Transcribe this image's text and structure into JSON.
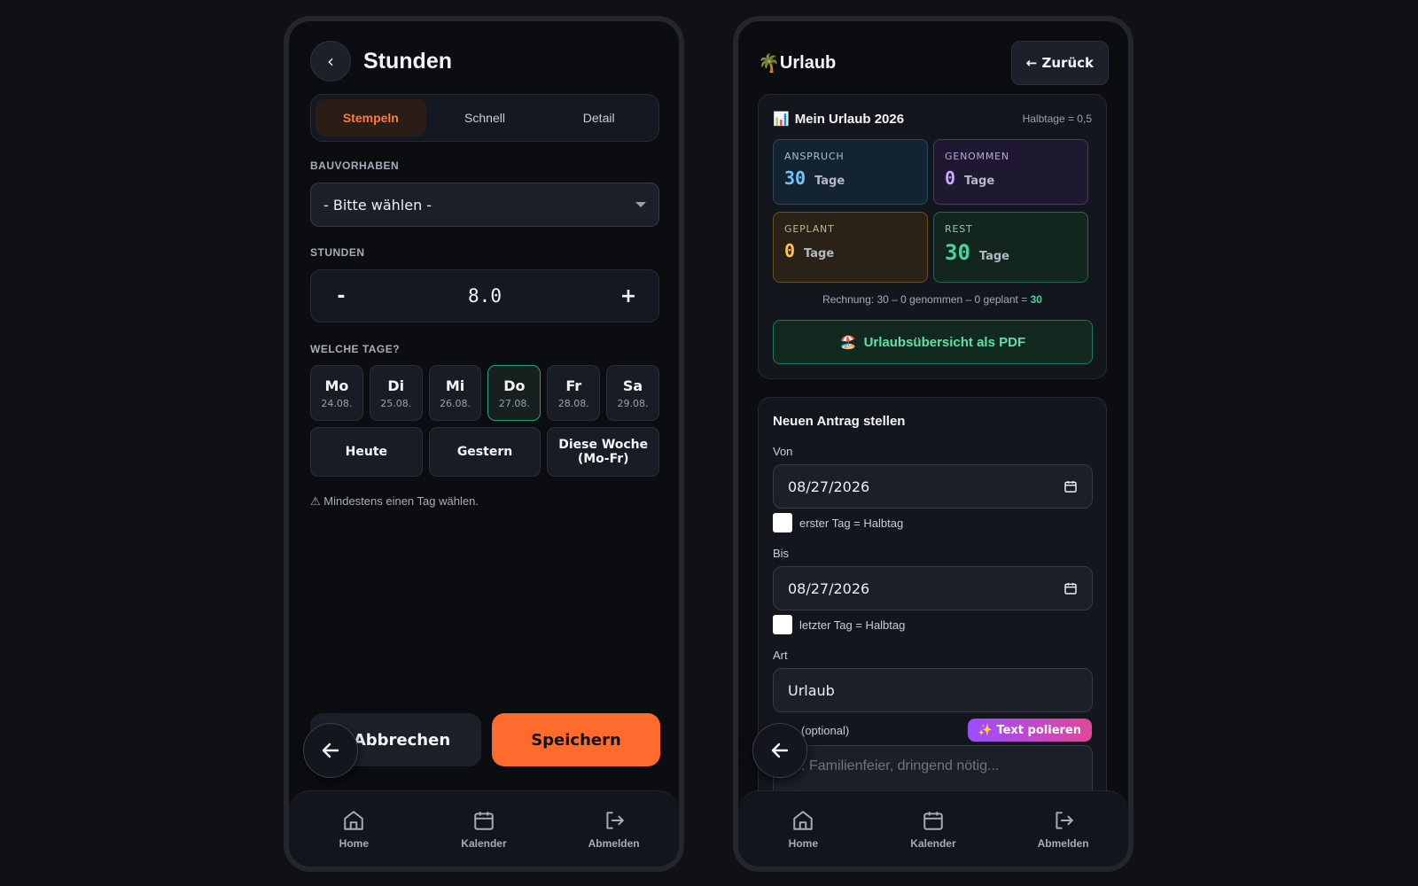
{
  "left": {
    "title": "Stunden",
    "tabs": [
      {
        "label": "Stempeln"
      },
      {
        "label": "Schnell"
      },
      {
        "label": "Detail"
      }
    ],
    "project_label": "BAUVORHABEN",
    "project_value": "- Bitte wählen -",
    "hours_label": "STUNDEN",
    "hours_minus": "-",
    "hours_value": "8.0",
    "hours_plus": "+",
    "days_label": "WELCHE TAGE?",
    "days": [
      {
        "name": "Mo",
        "date": "24.08."
      },
      {
        "name": "Di",
        "date": "25.08."
      },
      {
        "name": "Mi",
        "date": "26.08."
      },
      {
        "name": "Do",
        "date": "27.08."
      },
      {
        "name": "Fr",
        "date": "28.08."
      },
      {
        "name": "Sa",
        "date": "29.08."
      }
    ],
    "quick": [
      "Heute",
      "Gestern",
      "Diese Woche (Mo-Fr)"
    ],
    "warning": "⚠ Mindestens einen Tag wählen.",
    "cancel_label": "Abbrechen",
    "save_label": "Speichern"
  },
  "right": {
    "title_icon": "🌴",
    "title": "Urlaub",
    "back_label": "← Zurück",
    "summary": {
      "icon": "📊",
      "title": "Mein Urlaub 2026",
      "note": "Halbtage = 0,5",
      "anspruch": {
        "label": "ANSPRUCH",
        "value": "30",
        "unit": "Tage"
      },
      "genommen": {
        "label": "GENOMMEN",
        "value": "0",
        "unit": "Tage"
      },
      "geplant": {
        "label": "GEPLANT",
        "value": "0",
        "unit": "Tage"
      },
      "rest": {
        "label": "REST",
        "value": "30",
        "unit": "Tage"
      },
      "calc_text": "Rechnung: 30 – 0 genommen – 0 geplant =",
      "calc_result": "30",
      "pdf_icon": "🏖️",
      "pdf_label": "Urlaubsübersicht als PDF"
    },
    "request": {
      "title": "Neuen Antrag stellen",
      "from_label": "Von",
      "from_value": "08/27/2026",
      "first_half_label": "erster Tag = Halbtag",
      "to_label": "Bis",
      "to_value": "08/27/2026",
      "last_half_label": "letzter Tag = Halbtag",
      "type_label": "Art",
      "type_value": "Urlaub",
      "reason_label": "(optional)",
      "polish_label": "✨ Text polieren",
      "reason_placeholder": ".B. Familienfeier, dringend nötig..."
    }
  },
  "nav": [
    {
      "label": "Home",
      "icon": "home-icon"
    },
    {
      "label": "Kalender",
      "icon": "calendar-icon"
    },
    {
      "label": "Abmelden",
      "icon": "logout-icon"
    }
  ],
  "colors": {
    "accent": "#ff6b2c",
    "success": "#4ad49b",
    "background": "#0b0d11"
  }
}
